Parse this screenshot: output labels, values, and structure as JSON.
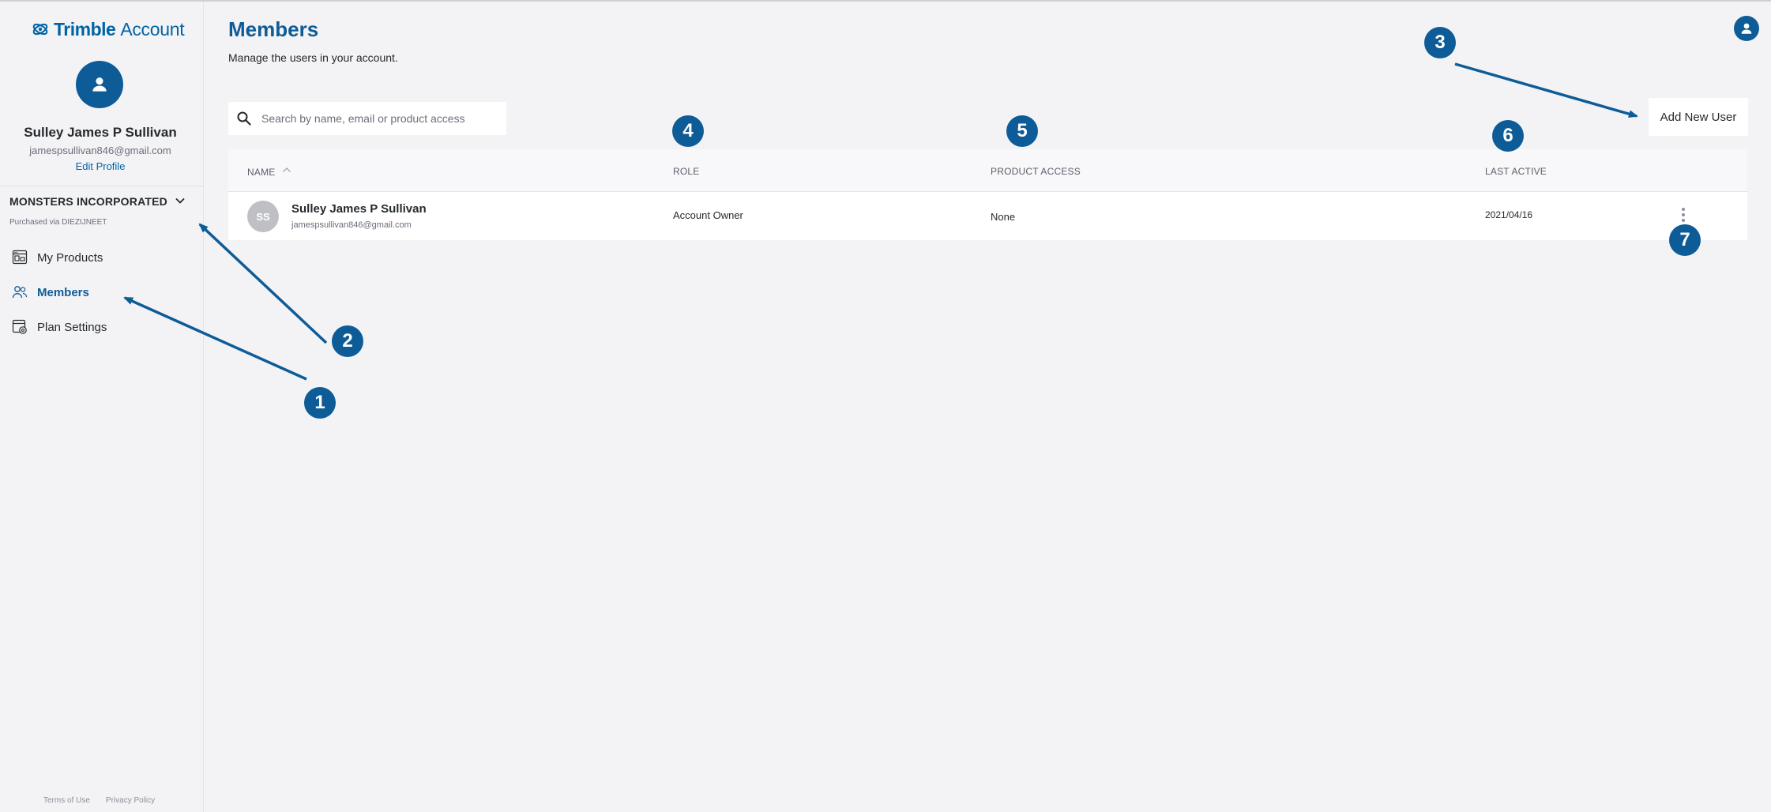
{
  "brand": {
    "name": "Trimble",
    "product": "Account"
  },
  "profile": {
    "name": "Sulley James P Sullivan",
    "email": "jamespsullivan846@gmail.com",
    "edit_label": "Edit Profile"
  },
  "organization": {
    "name": "MONSTERS INCORPORATED",
    "purchased_via": "Purchased via DIEZIJNEET"
  },
  "nav": {
    "items": [
      {
        "label": "My Products",
        "icon": "products-icon"
      },
      {
        "label": "Members",
        "icon": "members-icon",
        "active": true
      },
      {
        "label": "Plan Settings",
        "icon": "plan-settings-icon"
      }
    ]
  },
  "footer": {
    "terms": "Terms of Use",
    "privacy": "Privacy Policy"
  },
  "page": {
    "title": "Members",
    "subtitle": "Manage the users in your account."
  },
  "search": {
    "placeholder": "Search by name, email or product access",
    "value": ""
  },
  "toolbar": {
    "add_user_label": "Add New User"
  },
  "table": {
    "columns": [
      "NAME",
      "ROLE",
      "PRODUCT ACCESS",
      "LAST ACTIVE"
    ],
    "rows": [
      {
        "initials": "SS",
        "name": "Sulley James P Sullivan",
        "email": "jamespsullivan846@gmail.com",
        "role": "Account Owner",
        "product_access": "None",
        "last_active": "2021/04/16"
      }
    ]
  },
  "annotations": {
    "badges": [
      "1",
      "2",
      "3",
      "4",
      "5",
      "6",
      "7"
    ]
  },
  "colors": {
    "accent": "#0e5c97",
    "link": "#0063a3",
    "background": "#f3f3f6",
    "text": "#252a2e"
  }
}
